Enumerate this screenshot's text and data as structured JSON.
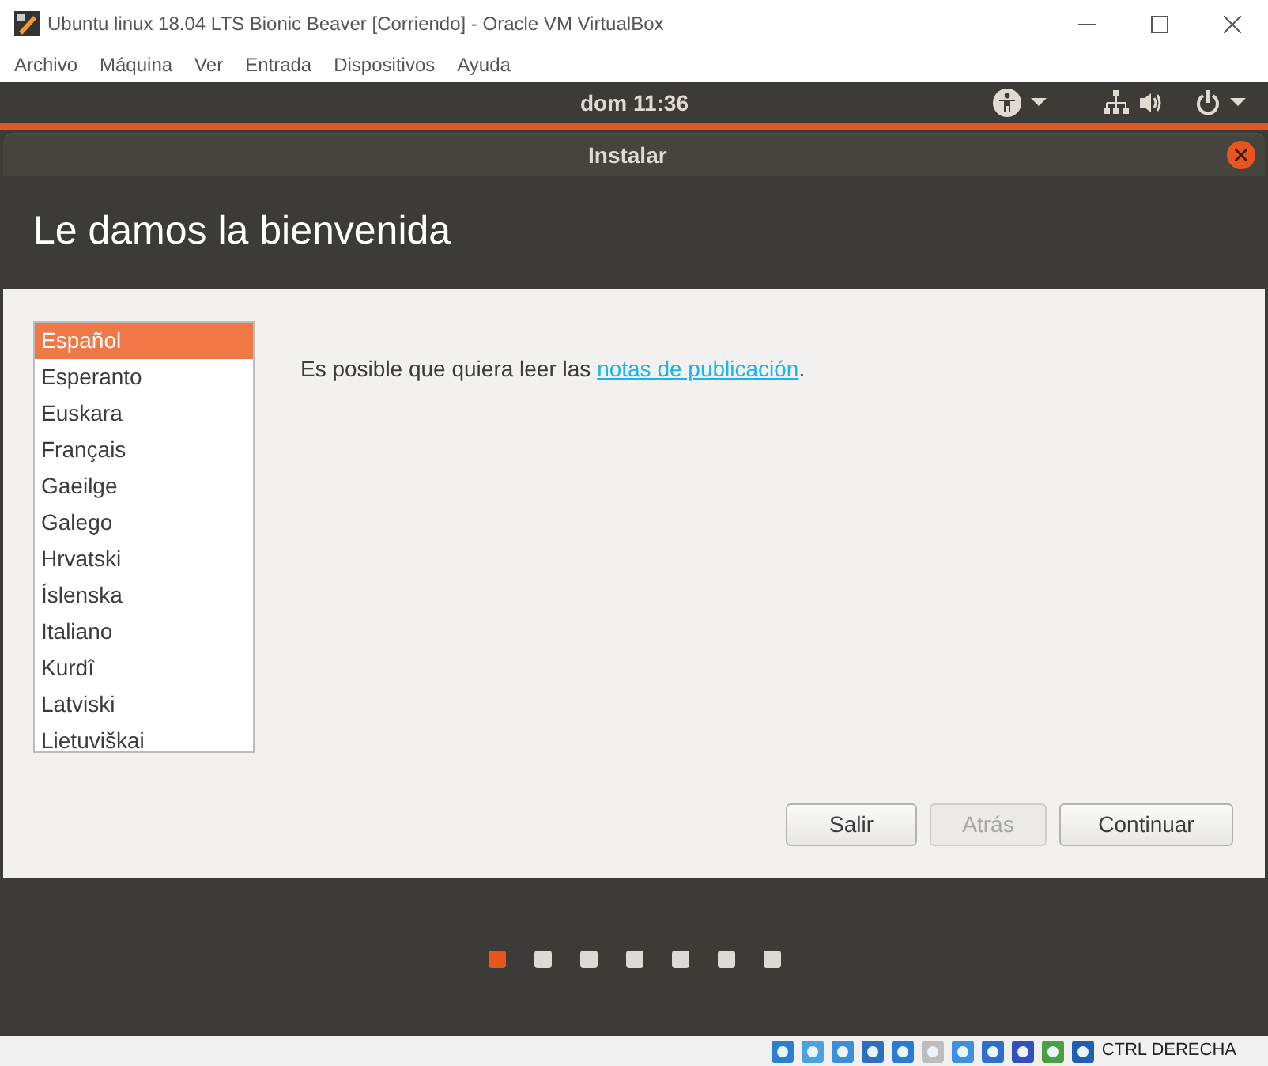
{
  "window": {
    "title": "Ubuntu linux 18.04 LTS Bionic Beaver [Corriendo] - Oracle VM VirtualBox"
  },
  "menu": [
    "Archivo",
    "Máquina",
    "Ver",
    "Entrada",
    "Dispositivos",
    "Ayuda"
  ],
  "top_bar": {
    "clock": "dom 11:36"
  },
  "installer": {
    "title": "Instalar",
    "heading": "Le damos la bienvenida",
    "languages": [
      {
        "label": "Español",
        "selected": true
      },
      {
        "label": "Esperanto",
        "selected": false
      },
      {
        "label": "Euskara",
        "selected": false
      },
      {
        "label": "Français",
        "selected": false
      },
      {
        "label": "Gaeilge",
        "selected": false
      },
      {
        "label": "Galego",
        "selected": false
      },
      {
        "label": "Hrvatski",
        "selected": false
      },
      {
        "label": "Íslenska",
        "selected": false
      },
      {
        "label": "Italiano",
        "selected": false
      },
      {
        "label": "Kurdî",
        "selected": false
      },
      {
        "label": "Latviski",
        "selected": false
      },
      {
        "label": "Lietuviškai",
        "selected": false
      }
    ],
    "message": "Es posible que quiera leer las ",
    "link": "notas de publicación",
    "message_end": ".",
    "buttons": [
      {
        "label": "Salir",
        "disabled": false
      },
      {
        "label": "Atrás",
        "disabled": true
      },
      {
        "label": "Continuar",
        "disabled": false
      }
    ],
    "steps": [
      {
        "selected": true
      },
      {
        "selected": false
      },
      {
        "selected": false
      },
      {
        "selected": false
      },
      {
        "selected": false
      },
      {
        "selected": false
      },
      {
        "selected": false
      }
    ]
  },
  "status_bar": {
    "host_key": "CTRL DERECHA"
  }
}
